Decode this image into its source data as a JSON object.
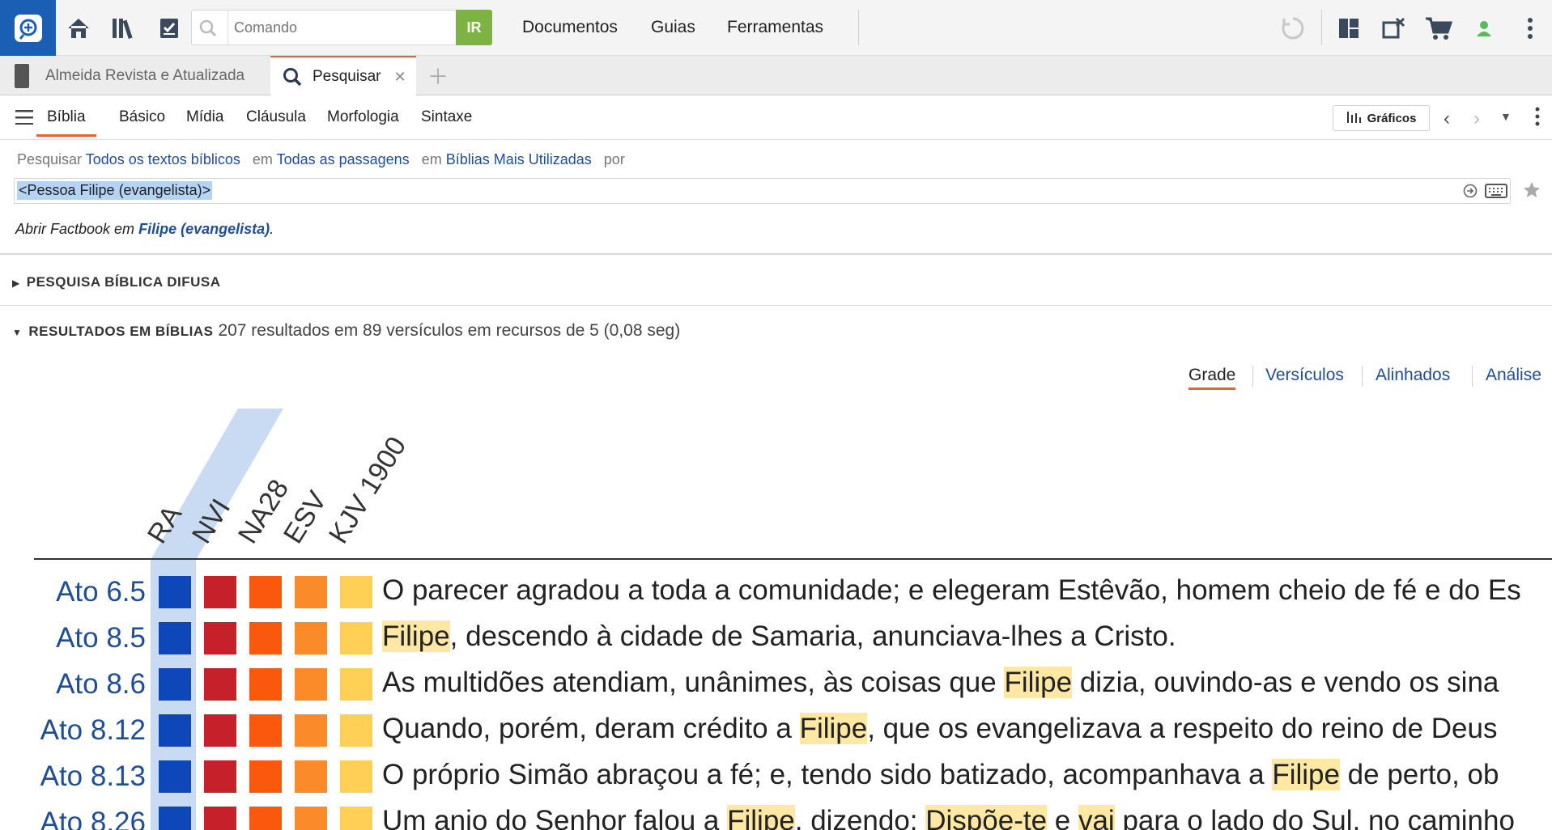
{
  "toolbar": {
    "command_placeholder": "Comando",
    "go_label": "IR",
    "menus": [
      "Documentos",
      "Guias",
      "Ferramentas"
    ]
  },
  "tabs": [
    {
      "label": "Almeida Revista e Atualizada",
      "active": false
    },
    {
      "label": "Pesquisar",
      "active": true
    }
  ],
  "subtabs": [
    "Bíblia",
    "Básico",
    "Mídia",
    "Cláusula",
    "Morfologia",
    "Sintaxe"
  ],
  "graficos_label": "Gráficos",
  "search": {
    "prefix": "Pesquisar",
    "scope": "Todos os textos bíblicos",
    "em1": "em",
    "passages": "Todas as passagens",
    "em2": "em",
    "bibles": "Bíblias Mais Utilizadas",
    "por": "por",
    "query": "<Pessoa Filipe (evangelista)>",
    "factbook_prefix": "Abrir Factbook em",
    "factbook_link": "Filipe (evangelista)",
    "factbook_suffix": "."
  },
  "sections": {
    "fuzzy": "PESQUISA BÍBLICA DIFUSA",
    "results": "RESULTADOS EM BÍBLIAS",
    "results_summary": "207 resultados em 89 versículos em recursos de 5 (0,08 seg)"
  },
  "views": [
    "Grade",
    "Versículos",
    "Alinhados",
    "Análise"
  ],
  "columns": [
    "RA",
    "NVI",
    "NA28",
    "ESV",
    "KJV 1900"
  ],
  "column_colors": [
    "#0e47b8",
    "#c6202a",
    "#f9580d",
    "#fb8a28",
    "#ffcf56"
  ],
  "rows": [
    {
      "ref": "Ato 6.5",
      "parts": [
        {
          "t": "O parecer agradou a toda a comunidade; e elegeram Estêvão, homem cheio de fé e do Es",
          "h": false
        }
      ]
    },
    {
      "ref": "Ato 8.5",
      "parts": [
        {
          "t": "Filipe",
          "h": true
        },
        {
          "t": ", descendo à cidade de Samaria, anunciava-lhes a Cristo.",
          "h": false
        }
      ]
    },
    {
      "ref": "Ato 8.6",
      "parts": [
        {
          "t": "As multidões atendiam, unânimes, às coisas que ",
          "h": false
        },
        {
          "t": "Filipe",
          "h": true
        },
        {
          "t": " dizia, ouvindo-as e vendo os sina",
          "h": false
        }
      ]
    },
    {
      "ref": "Ato 8.12",
      "parts": [
        {
          "t": "Quando, porém, deram crédito a ",
          "h": false
        },
        {
          "t": "Filipe",
          "h": true
        },
        {
          "t": ", que os evangelizava a respeito do reino de Deus",
          "h": false
        }
      ]
    },
    {
      "ref": "Ato 8.13",
      "parts": [
        {
          "t": "O próprio Simão abraçou a fé; e, tendo sido batizado, acompanhava a ",
          "h": false
        },
        {
          "t": "Filipe",
          "h": true
        },
        {
          "t": " de perto, ob",
          "h": false
        }
      ]
    },
    {
      "ref": "Ato 8.26",
      "parts": [
        {
          "t": "Um anjo do Senhor falou a ",
          "h": false
        },
        {
          "t": "Filipe",
          "h": true
        },
        {
          "t": ", dizendo: ",
          "h": false
        },
        {
          "t": "Dispõe-te",
          "h": true
        },
        {
          "t": " e ",
          "h": false
        },
        {
          "t": "vai",
          "h": true
        },
        {
          "t": " para o lado do Sul, no caminho",
          "h": false
        }
      ]
    }
  ]
}
